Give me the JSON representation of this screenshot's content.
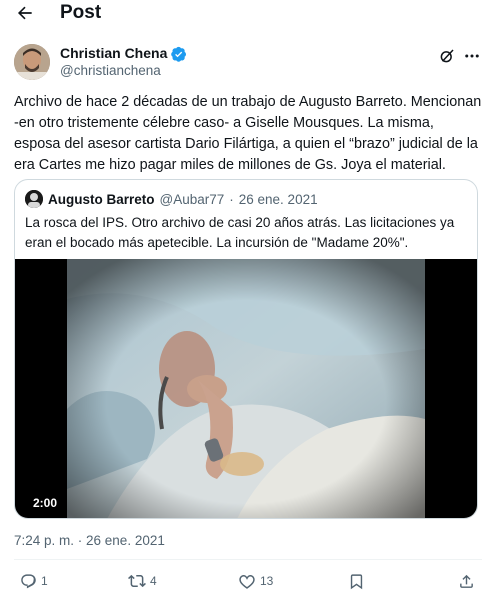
{
  "header": {
    "title": "Post"
  },
  "post": {
    "author_name": "Christian Chena",
    "author_handle": "@christianchena",
    "text": "Archivo de hace 2 décadas de un trabajo de Augusto Barreto. Mencionan\n-en otro tristemente célebre caso- a Giselle Mousques. La misma,\nesposa del asesor cartista Dario Filártiga, a quien el “brazo” judicial de la\nera Cartes me hizo pagar miles de millones de Gs. Joya el material.",
    "timestamp": "7:24 p. m. · 26 ene. 2021"
  },
  "quote": {
    "author_name": "Augusto Barreto",
    "author_handle": "@Aubar77",
    "separator": "·",
    "date": "26 ene. 2021",
    "text": "La rosca del IPS. Otro archivo de casi 20 años atrás. Las licitaciones ya eran el bocado más apetecible. La incursión de \"Madame 20%\".",
    "video_duration": "2:00"
  },
  "actions": {
    "replies": "1",
    "reposts": "4",
    "likes": "13"
  },
  "colors": {
    "text": "#0f1419",
    "muted": "#536471",
    "border": "#cfd9de",
    "verified": "#1d9bf0"
  },
  "icons": [
    "back-arrow-icon",
    "verified-badge-icon",
    "grok-icon",
    "more-icon",
    "reply-icon",
    "repost-icon",
    "like-icon",
    "bookmark-icon",
    "share-icon"
  ]
}
